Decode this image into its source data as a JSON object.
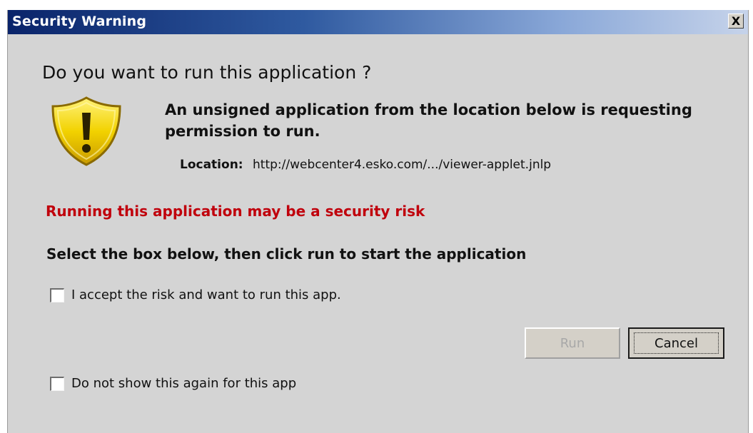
{
  "window": {
    "title": "Security Warning",
    "close_glyph": "X"
  },
  "dialog": {
    "question": "Do you want to run this application ?",
    "info_text": "An unsigned application from the location below is requesting permission to run.",
    "location_label": "Location:",
    "location_value": "http://webcenter4.esko.com/.../viewer-applet.jnlp",
    "risk_text": "Running this application may be a security risk",
    "instruction": "Select the box below, then click run to start the application",
    "accept_checkbox": {
      "label": "I accept the risk and want to run this app.",
      "checked": false
    },
    "noshow_checkbox": {
      "label": "Do not show this again for this app",
      "checked": false
    },
    "icon": "warning-shield-icon"
  },
  "buttons": {
    "run_label": "Run",
    "run_enabled": false,
    "cancel_label": "Cancel"
  },
  "colors": {
    "title_bar_start": "#0a246a",
    "title_bar_end": "#c6d3ea",
    "dialog_background": "#d4d4d4",
    "risk_text": "#c0000c",
    "shield_fill": "#f2d200"
  }
}
